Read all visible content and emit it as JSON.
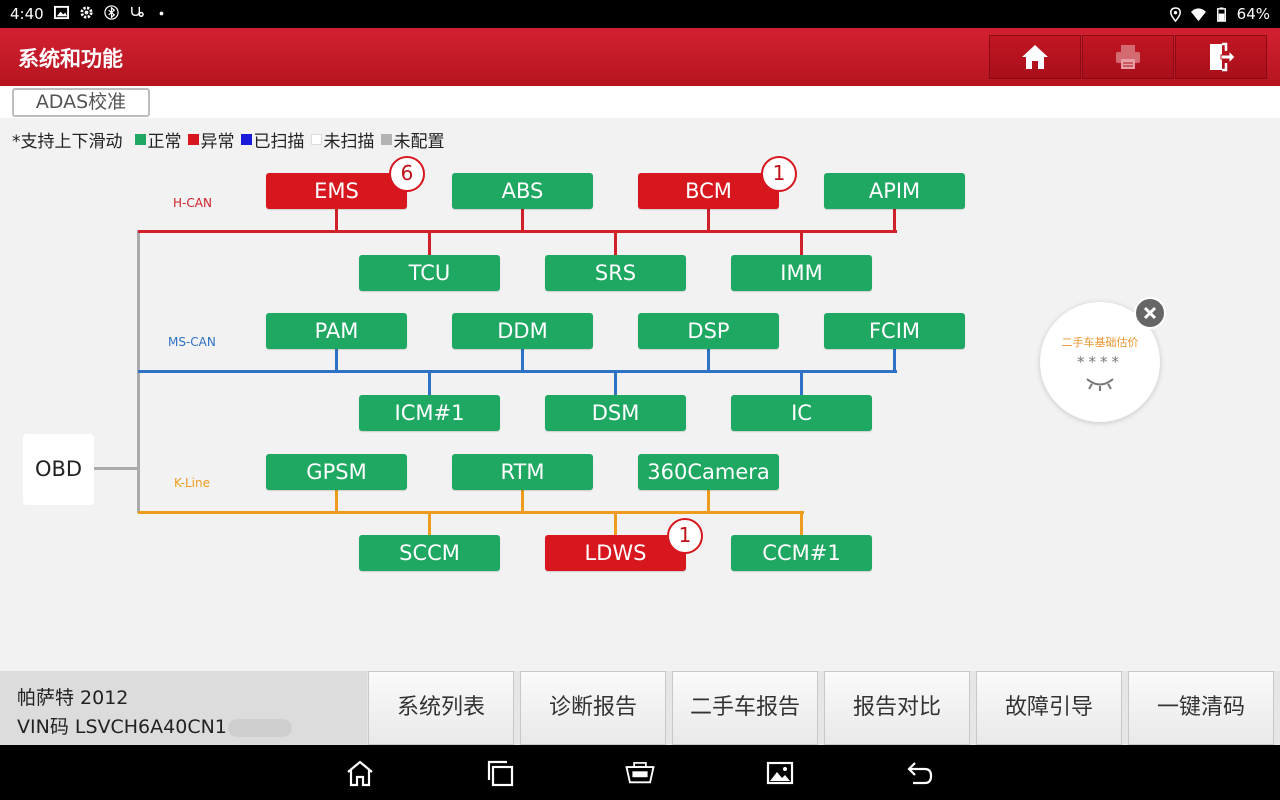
{
  "status_bar": {
    "time": "4:40",
    "battery": "64%",
    "left_icons": [
      "image-icon",
      "gear-icon",
      "bluetooth-icon",
      "stethoscope-icon",
      "dot-icon"
    ],
    "right_icons": [
      "location-icon",
      "wifi-icon",
      "battery-icon"
    ]
  },
  "header": {
    "title": "系统和功能",
    "buttons": [
      "home-icon",
      "print-icon",
      "exit-icon"
    ]
  },
  "adas_button": "ADAS校准",
  "legend": {
    "prefix": "*支持上下滑动",
    "items": [
      {
        "label": "正常",
        "color": "#1fa862"
      },
      {
        "label": "异常",
        "color": "#d8161e"
      },
      {
        "label": "已扫描",
        "color": "#1a1adb"
      },
      {
        "label": "未扫描",
        "color": "#ffffff"
      },
      {
        "label": "未配置",
        "color": "#b3b3b3"
      }
    ]
  },
  "obd_label": "OBD",
  "buses": [
    {
      "name": "H-CAN",
      "color": "#d0202a"
    },
    {
      "name": "MS-CAN",
      "color": "#2e72c6"
    },
    {
      "name": "K-Line",
      "color": "#ee9c1d"
    }
  ],
  "modules": {
    "hcan_top": [
      {
        "name": "EMS",
        "status": "abnormal",
        "faults": "6"
      },
      {
        "name": "ABS",
        "status": "normal"
      },
      {
        "name": "BCM",
        "status": "abnormal",
        "faults": "1"
      },
      {
        "name": "APIM",
        "status": "normal"
      }
    ],
    "hcan_bottom": [
      {
        "name": "TCU",
        "status": "normal"
      },
      {
        "name": "SRS",
        "status": "normal"
      },
      {
        "name": "IMM",
        "status": "normal"
      }
    ],
    "mscan_top": [
      {
        "name": "PAM",
        "status": "normal"
      },
      {
        "name": "DDM",
        "status": "normal"
      },
      {
        "name": "DSP",
        "status": "normal"
      },
      {
        "name": "FCIM",
        "status": "normal"
      }
    ],
    "mscan_bottom": [
      {
        "name": "ICM#1",
        "status": "normal"
      },
      {
        "name": "DSM",
        "status": "normal"
      },
      {
        "name": "IC",
        "status": "normal"
      }
    ],
    "kline_top": [
      {
        "name": "GPSM",
        "status": "normal"
      },
      {
        "name": "RTM",
        "status": "normal"
      },
      {
        "name": "360Camera",
        "status": "normal"
      }
    ],
    "kline_bottom": [
      {
        "name": "SCCM",
        "status": "normal"
      },
      {
        "name": "LDWS",
        "status": "abnormal",
        "faults": "1"
      },
      {
        "name": "CCM#1",
        "status": "normal"
      }
    ]
  },
  "valuation_widget": {
    "title": "二手车基础估价",
    "masked_value": "****"
  },
  "vehicle": {
    "model": "帕萨特 2012",
    "vin": "VIN码 LSVCH6A40CN1"
  },
  "footer_buttons": [
    "系统列表",
    "诊断报告",
    "二手车报告",
    "报告对比",
    "故障引导",
    "一键清码"
  ],
  "nav_buttons": [
    "home-icon",
    "recent-apps-icon",
    "vci-icon",
    "screenshot-icon",
    "back-icon"
  ]
}
